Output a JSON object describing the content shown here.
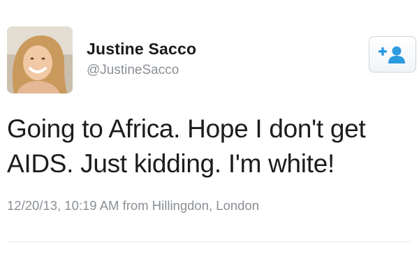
{
  "author": {
    "name": "Justine Sacco",
    "handle": "@JustineSacco",
    "avatar_icon": "profile-photo"
  },
  "follow_button": {
    "icon": "add-user-icon",
    "accent_color": "#2b9be0"
  },
  "tweet": {
    "text_lines": [
      "Going to Africa. Hope I don't get",
      "AIDS. Just kidding. I'm white!"
    ],
    "timestamp": "12/20/13, 10:19 AM",
    "location_text": "from Hillingdon, London"
  }
}
